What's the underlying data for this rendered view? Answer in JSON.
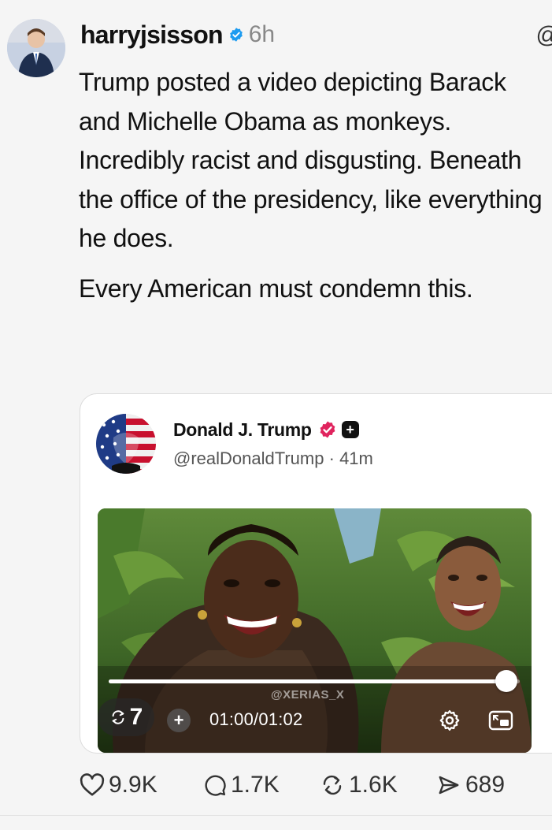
{
  "post": {
    "username": "harryjsisson",
    "time_ago": "6h",
    "paragraphs": [
      "Trump posted a video depicting Barack and Michelle Obama as monkeys. Incredibly racist and disgusting. Beneath the office of the presidency, like everything he does.",
      "Every American must condemn this."
    ]
  },
  "quoted_post": {
    "display_name": "Donald J. Trump",
    "handle": "@realDonaldTrump",
    "separator": "·",
    "time_ago": "41m",
    "video": {
      "watermark": "@XERIAS_X",
      "replay_count": "7",
      "time_label": "01:00/01:02",
      "progress": 0.968
    }
  },
  "actions": {
    "likes": "9.9K",
    "replies": "1.7K",
    "reposts": "1.6K",
    "shares": "689"
  },
  "colors": {
    "verified_blue": "#1d9bf0",
    "trump_badge_red": "#e0245e"
  }
}
